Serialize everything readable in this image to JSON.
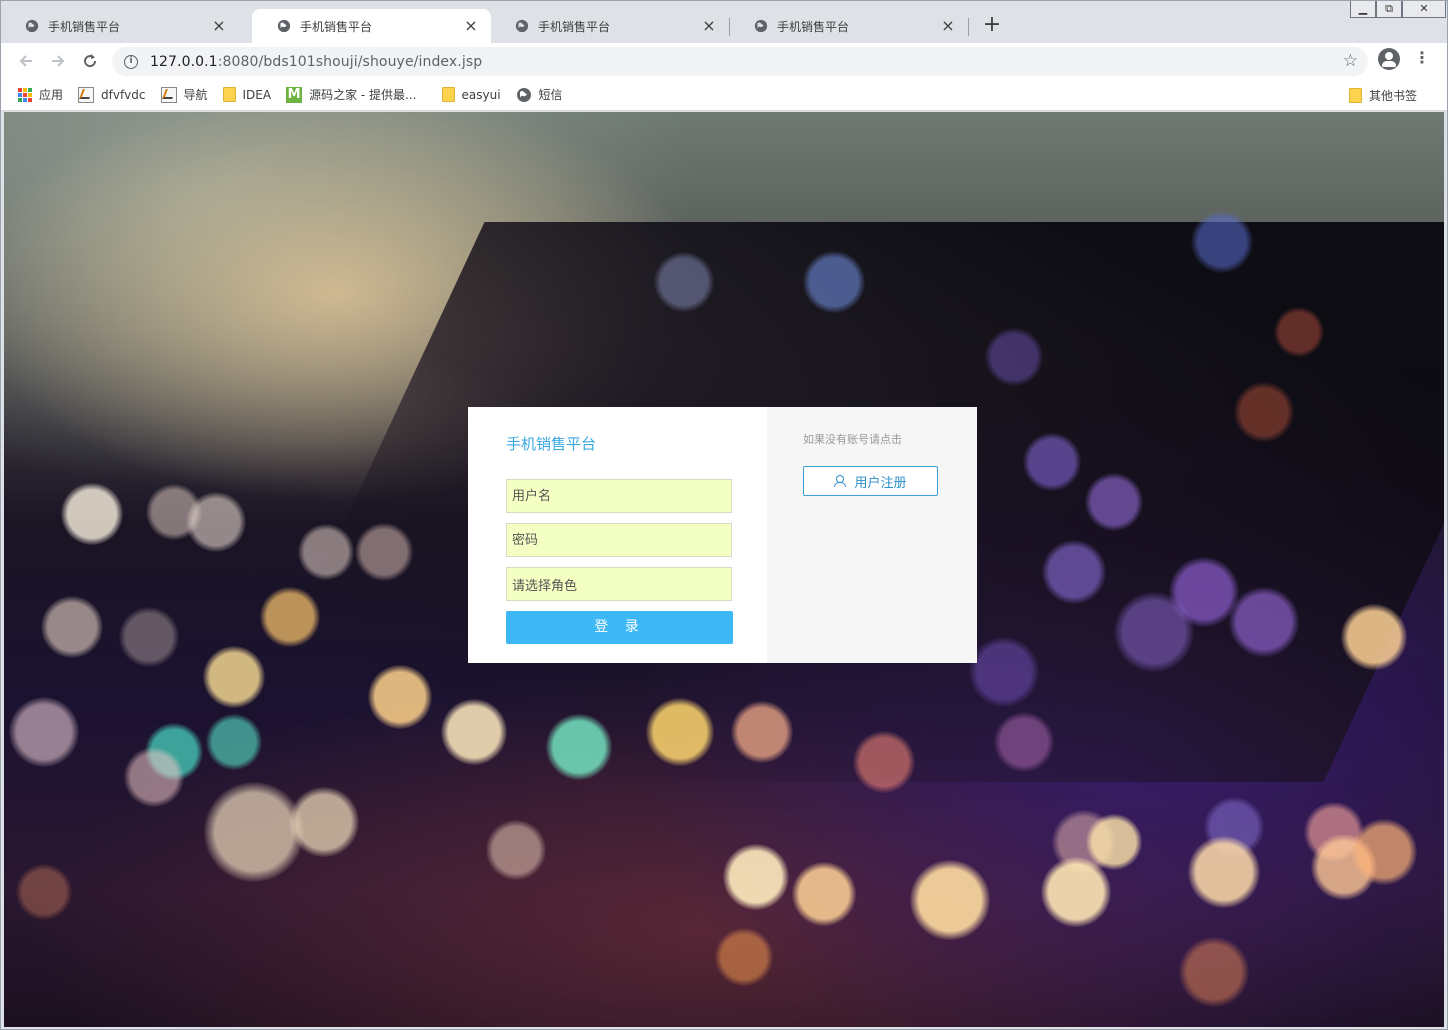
{
  "browser": {
    "tabs": [
      {
        "title": "手机销售平台",
        "close": "×",
        "active": false
      },
      {
        "title": "手机销售平台",
        "close": "×",
        "active": true
      },
      {
        "title": "手机销售平台",
        "close": "×",
        "active": false
      },
      {
        "title": "手机销售平台",
        "close": "×",
        "active": false
      }
    ],
    "new_tab": "+",
    "url_host": "127.0.0.1",
    "url_rest": ":8080/bds101shouji/shouye/index.jsp",
    "bookmarks": [
      {
        "label": "应用",
        "icon": "apps-grid-icon"
      },
      {
        "label": "dfvfvdc",
        "icon": "chart-favicon"
      },
      {
        "label": "导航",
        "icon": "chart-favicon"
      },
      {
        "label": "IDEA",
        "icon": "folder-icon"
      },
      {
        "label": "源码之家 - 提供最...",
        "icon": "m-logo-favicon"
      },
      {
        "label": "easyui",
        "icon": "folder-icon"
      },
      {
        "label": "短信",
        "icon": "globe-icon"
      }
    ],
    "other_bookmarks": "其他书签",
    "colors": {
      "tabstrip": "#dee1e6",
      "omnibox": "#f1f3f4"
    }
  },
  "page": {
    "title": "手机销售平台",
    "username_placeholder": "用户名",
    "password_placeholder": "密码",
    "role_placeholder": "请选择角色",
    "login_label": "登 录",
    "register_hint": "如果没有账号请点击",
    "register_label": "用户注册",
    "colors": {
      "accent": "#39a9e0",
      "button": "#3db8f5",
      "field_bg": "#f4ffc4"
    }
  }
}
